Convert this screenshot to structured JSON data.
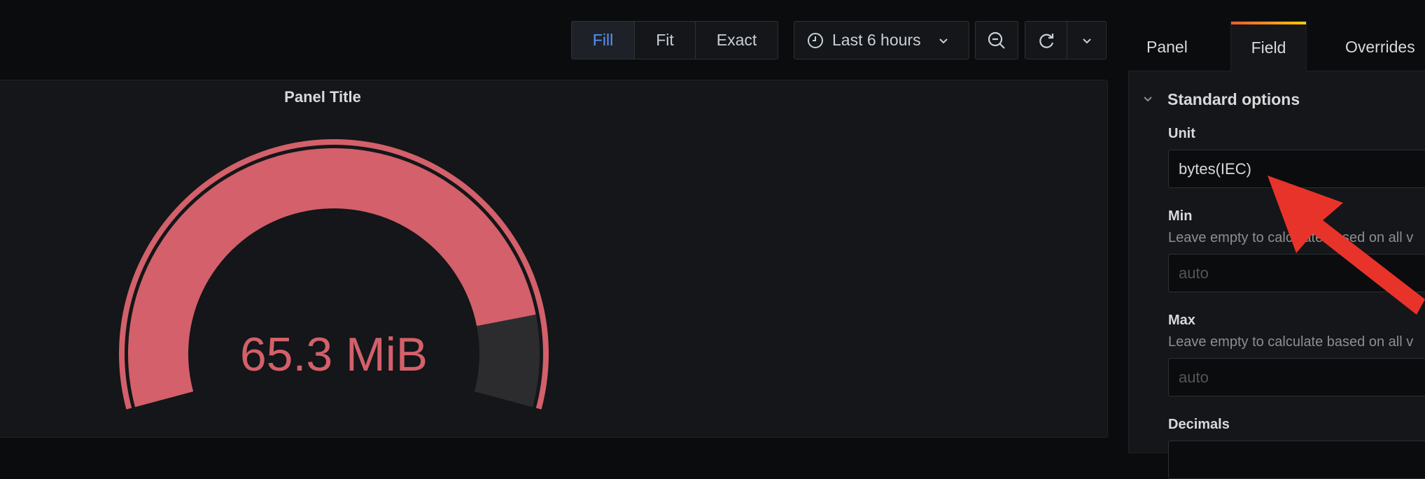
{
  "toolbar": {
    "view_modes": [
      {
        "label": "Fill",
        "active": true
      },
      {
        "label": "Fit",
        "active": false
      },
      {
        "label": "Exact",
        "active": false
      }
    ],
    "time_range": "Last 6 hours",
    "icons": {
      "time": "clock-icon",
      "zoom_out": "zoom-out-icon",
      "refresh": "refresh-icon",
      "dropdown": "chevron-down-icon"
    }
  },
  "panel": {
    "title": "Panel Title",
    "gauge": {
      "value_text": "65.3 MiB",
      "fill_fraction": 0.876,
      "color": "#d3606a",
      "track_color": "#2c2c2e"
    }
  },
  "editor": {
    "tabs": [
      {
        "label": "Panel",
        "active": false
      },
      {
        "label": "Field",
        "active": true
      },
      {
        "label": "Overrides",
        "active": false
      }
    ],
    "section_title": "Standard options",
    "unit": {
      "label": "Unit",
      "value": "bytes(IEC)"
    },
    "min": {
      "label": "Min",
      "help": "Leave empty to calculate based on all v",
      "placeholder": "auto"
    },
    "max": {
      "label": "Max",
      "help": "Leave empty to calculate based on all v",
      "placeholder": "auto"
    },
    "decimals": {
      "label": "Decimals"
    }
  },
  "annotation": {
    "color": "#e8332a",
    "icon": "arrow-annotation"
  }
}
